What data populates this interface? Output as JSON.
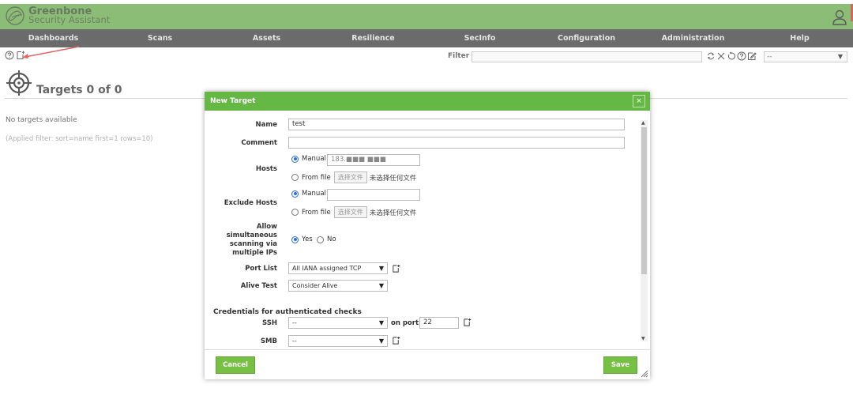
{
  "app": {
    "title": "Greenbone",
    "subtitle": "Security Assistant"
  },
  "menu": [
    {
      "label": "Dashboards",
      "key": "dashboards"
    },
    {
      "label": "Scans",
      "key": "scans"
    },
    {
      "label": "Assets",
      "key": "assets"
    },
    {
      "label": "Resilience",
      "key": "resilience"
    },
    {
      "label": "SecInfo",
      "key": "secinfo"
    },
    {
      "label": "Configuration",
      "key": "configuration"
    },
    {
      "label": "Administration",
      "key": "administration"
    },
    {
      "label": "Help",
      "key": "help"
    }
  ],
  "filter": {
    "label": "Filter",
    "value": "",
    "select_value": "--"
  },
  "page": {
    "title": "Targets 0 of 0",
    "empty_text": "No targets available",
    "applied_filter": "(Applied filter: sort=name first=1 rows=10)"
  },
  "dialog": {
    "title": "New Target",
    "close_label": "×",
    "fields": {
      "name_label": "Name",
      "name_value": "test",
      "comment_label": "Comment",
      "comment_value": "",
      "hosts_label": "Hosts",
      "manual_label": "Manual",
      "hosts_manual_value": "183.■■■ ■■■",
      "from_file_label": "From file",
      "file_button": "选择文件",
      "file_none": "未选择任何文件",
      "exclude_label": "Exclude Hosts",
      "exclude_manual_value": "",
      "allow_label_1": "Allow",
      "allow_label_2": "simultaneous",
      "allow_label_3": "scanning via",
      "allow_label_4": "multiple IPs",
      "yes_label": "Yes",
      "no_label": "No",
      "port_list_label": "Port List",
      "port_list_value": "All IANA assigned TCP",
      "alive_test_label": "Alive Test",
      "alive_test_value": "Consider Alive",
      "credentials_title": "Credentials for authenticated checks",
      "ssh_label": "SSH",
      "ssh_value": "--",
      "on_port_label": "on port",
      "ssh_port": "22",
      "smb_label": "SMB",
      "smb_value": "--"
    },
    "cancel_label": "Cancel",
    "save_label": "Save"
  },
  "colors": {
    "header_green": "#66a74a",
    "menu_dark": "#3a3a3a",
    "dialog_green": "#66b845",
    "button_green": "#76c043"
  }
}
